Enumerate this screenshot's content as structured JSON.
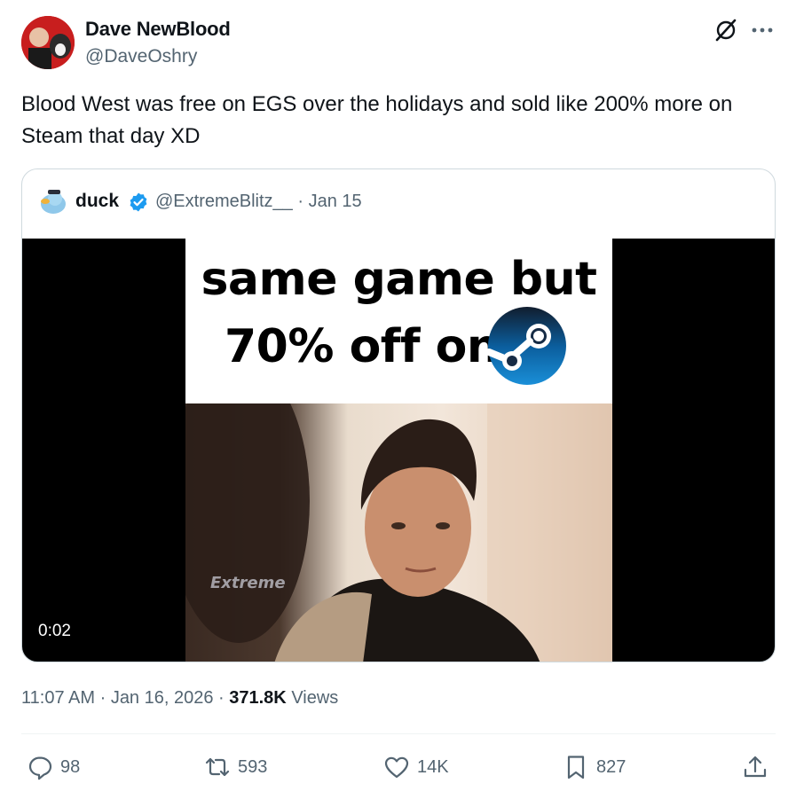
{
  "author": {
    "name": "Dave NewBlood",
    "handle": "@DaveOshry"
  },
  "tweet": {
    "text": "Blood West was free on EGS over the holidays and sold like 200% more on Steam that day XD"
  },
  "quote": {
    "name": "duck",
    "handle": "@ExtremeBlitz__",
    "date": "Jan 15",
    "media": {
      "caption_line1": "same game but",
      "caption_line2": "70% off on",
      "watermark": "Extreme",
      "duration": "0:02"
    }
  },
  "meta": {
    "time": "11:07 AM",
    "date": "Jan 16, 2026",
    "views_count": "371.8K",
    "views_label": "Views"
  },
  "actions": {
    "replies": "98",
    "reposts": "593",
    "likes": "14K",
    "bookmarks": "827"
  },
  "colors": {
    "text": "#0f1419",
    "secondary": "#536471",
    "verified": "#1d9bf0",
    "border": "#cfd9de"
  },
  "icons": [
    "grok-icon",
    "more-icon",
    "verified-icon",
    "steam-logo-icon",
    "reply-icon",
    "repost-icon",
    "like-icon",
    "bookmark-icon",
    "share-icon"
  ]
}
